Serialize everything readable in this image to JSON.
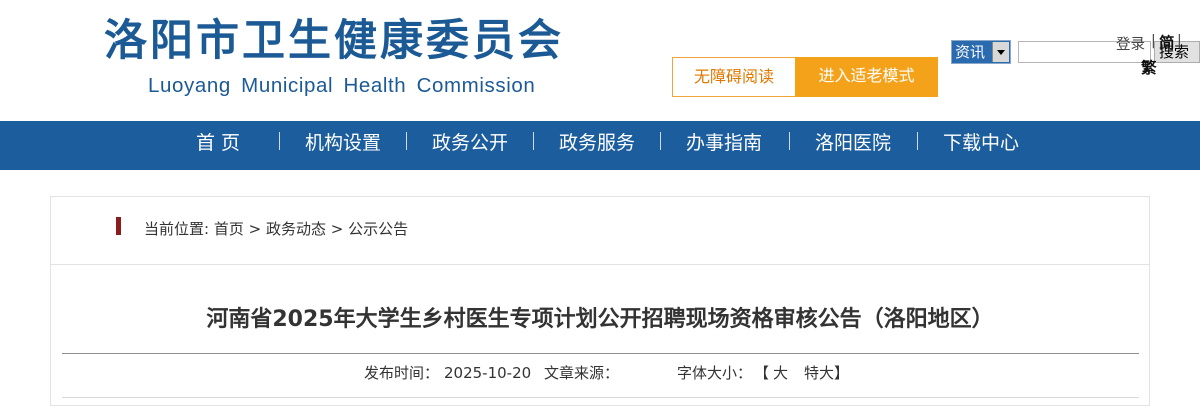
{
  "header": {
    "title_cn": "洛阳市卫生健康委员会",
    "title_en": "Luoyang Municipal Health Commission",
    "accessibility_button": "无障碍阅读",
    "elder_mode_button": "进入适老模式",
    "brand_color": "#1c5a96",
    "accent_color": "#f5a21b"
  },
  "search": {
    "category": "资讯",
    "query": "",
    "button": "搜索"
  },
  "top_links": {
    "login": "登录",
    "separator": "|",
    "simplified": "简",
    "traditional": "繁"
  },
  "nav": {
    "items": [
      "首 页",
      "机构设置",
      "政务公开",
      "政务服务",
      "办事指南",
      "洛阳医院",
      "下载中心"
    ],
    "background": "#1c5d9e"
  },
  "breadcrumb": {
    "prefix": "当前位置:",
    "items": [
      "首页",
      "政务动态",
      "公示公告"
    ],
    "separator": ">"
  },
  "article": {
    "title": "河南省2025年大学生乡村医生专项计划公开招聘现场资格审核公告（洛阳地区）",
    "publish_label": "发布时间：",
    "publish_date": "2025-10-20",
    "source_label": "文章来源：",
    "source_value": "",
    "font_size_label": "字体大小：",
    "font_size_open": "【",
    "font_large": "大",
    "font_xlarge": "特大",
    "font_size_close": "】"
  }
}
